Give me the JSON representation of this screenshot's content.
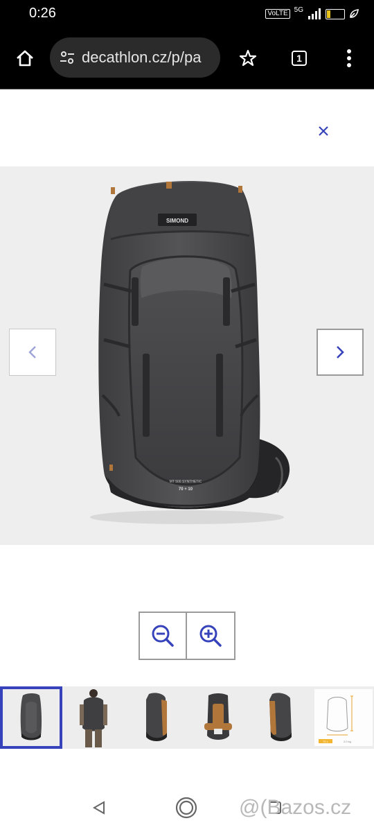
{
  "status_bar": {
    "time": "0:26",
    "volte": "VoLTE",
    "network": "5G",
    "battery_level": "19",
    "battery_fraction": 0.19
  },
  "browser": {
    "url": "decathlon.cz/p/pa",
    "tab_count": "1",
    "icons": [
      "home-icon",
      "site-settings-icon",
      "bookmark-star-icon",
      "tab-switcher-icon",
      "more-menu-icon"
    ]
  },
  "viewer": {
    "close_symbol": "×",
    "product_logo": "SIMOND",
    "product_capacity": "70 + 10",
    "product_model_text": "MT 500 SYNTHETIC",
    "controls": [
      "prev-arrow-icon",
      "next-arrow-icon",
      "zoom-out-icon",
      "zoom-in-icon"
    ]
  },
  "thumbnails": {
    "selected_index": 0,
    "items": [
      "front view",
      "worn on back",
      "side view",
      "back panel",
      "side view",
      "size chart"
    ],
    "chart_labels": [
      "70 L",
      "2.0 kg"
    ]
  },
  "watermark": "@(Bazos.cz",
  "colors": {
    "accent": "#3643ba",
    "pack_body": "#4a4a4c",
    "pack_dark": "#2a2a2c",
    "pack_orange": "#b0763a"
  }
}
